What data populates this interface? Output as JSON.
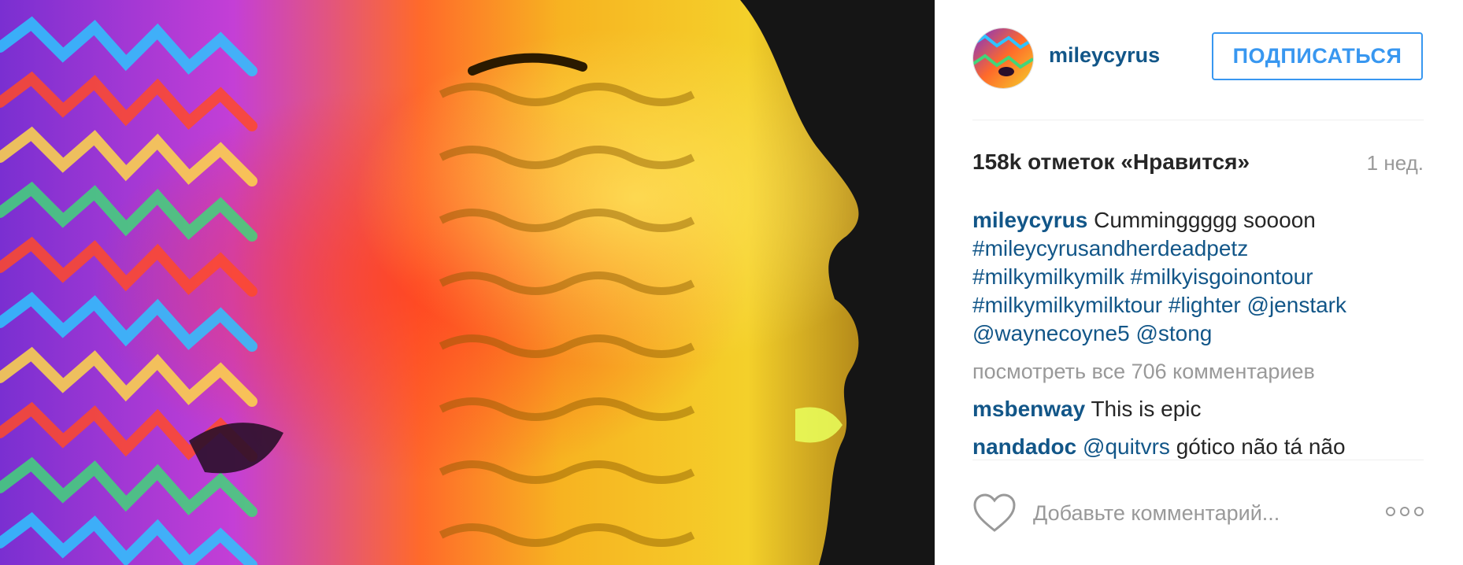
{
  "post": {
    "image_icon": "psychedelic-face-photo"
  },
  "header": {
    "username": "mileycyrus",
    "follow_label": "ПОДПИСАТЬСЯ"
  },
  "stats": {
    "likes": "158k отметок «Нравится»",
    "time": "1 нед."
  },
  "caption": {
    "author": "mileycyrus",
    "text": "Cumminggggg soooon",
    "tags": [
      "#mileycyrusandherdeadpetz",
      "#milkymilkymilk",
      "#milkyisgoinontour",
      "#milkymilkymilktour",
      "#lighter",
      "@jenstark",
      "@waynecoyne5",
      "@stong"
    ]
  },
  "view_all": "посмотреть все 706 комментариев",
  "comments": [
    {
      "author": "msbenway",
      "text": "This is epic"
    },
    {
      "author": "nandadoc",
      "mention": "@quitvrs",
      "text": "gótico não tá não"
    }
  ],
  "footer": {
    "comment_placeholder": "Добавьте комментарий...",
    "like_icon": "heart-outline-icon",
    "more_icon": "more-options-icon"
  },
  "colors": {
    "link": "#125688",
    "follow": "#3897f0",
    "muted": "#999999"
  }
}
